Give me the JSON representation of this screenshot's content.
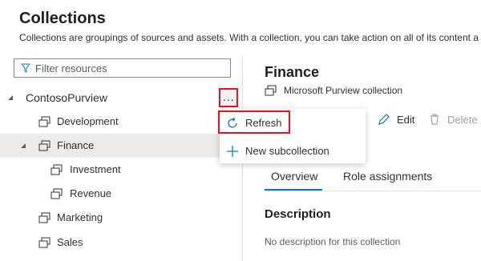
{
  "header": {
    "title": "Collections",
    "subtitle": "Collections are groupings of sources and assets. With a collection, you can take action on all of its content a"
  },
  "filter": {
    "placeholder": "Filter resources",
    "icon": "filter-icon"
  },
  "tree": {
    "root": {
      "label": "ContosoPurview",
      "expanded": true
    },
    "items": [
      {
        "label": "Development",
        "level": 1,
        "expanded": null
      },
      {
        "label": "Finance",
        "level": 1,
        "expanded": true,
        "selected": true
      },
      {
        "label": "Investment",
        "level": 2
      },
      {
        "label": "Revenue",
        "level": 2
      },
      {
        "label": "Marketing",
        "level": 1
      },
      {
        "label": "Sales",
        "level": 1
      }
    ],
    "more_label": "..."
  },
  "context_menu": {
    "items": [
      {
        "label": "Refresh",
        "icon": "refresh-icon",
        "highlighted": true
      },
      {
        "label": "New subcollection",
        "icon": "plus-icon"
      }
    ]
  },
  "detail": {
    "title": "Finance",
    "subtitle": "Microsoft Purview collection",
    "commands": [
      {
        "label": "Edit",
        "icon": "pencil-icon",
        "enabled": true
      },
      {
        "label": "Delete",
        "icon": "trash-icon",
        "enabled": false
      }
    ],
    "tabs": [
      {
        "label": "Overview",
        "active": true
      },
      {
        "label": "Role assignments",
        "active": false
      }
    ],
    "description_title": "Description",
    "description_text": "No description for this collection"
  },
  "colors": {
    "accent": "#0078d4",
    "highlight_border": "#e81123",
    "selected_row": "#edebe9",
    "disabled_text": "#a19f9d"
  }
}
